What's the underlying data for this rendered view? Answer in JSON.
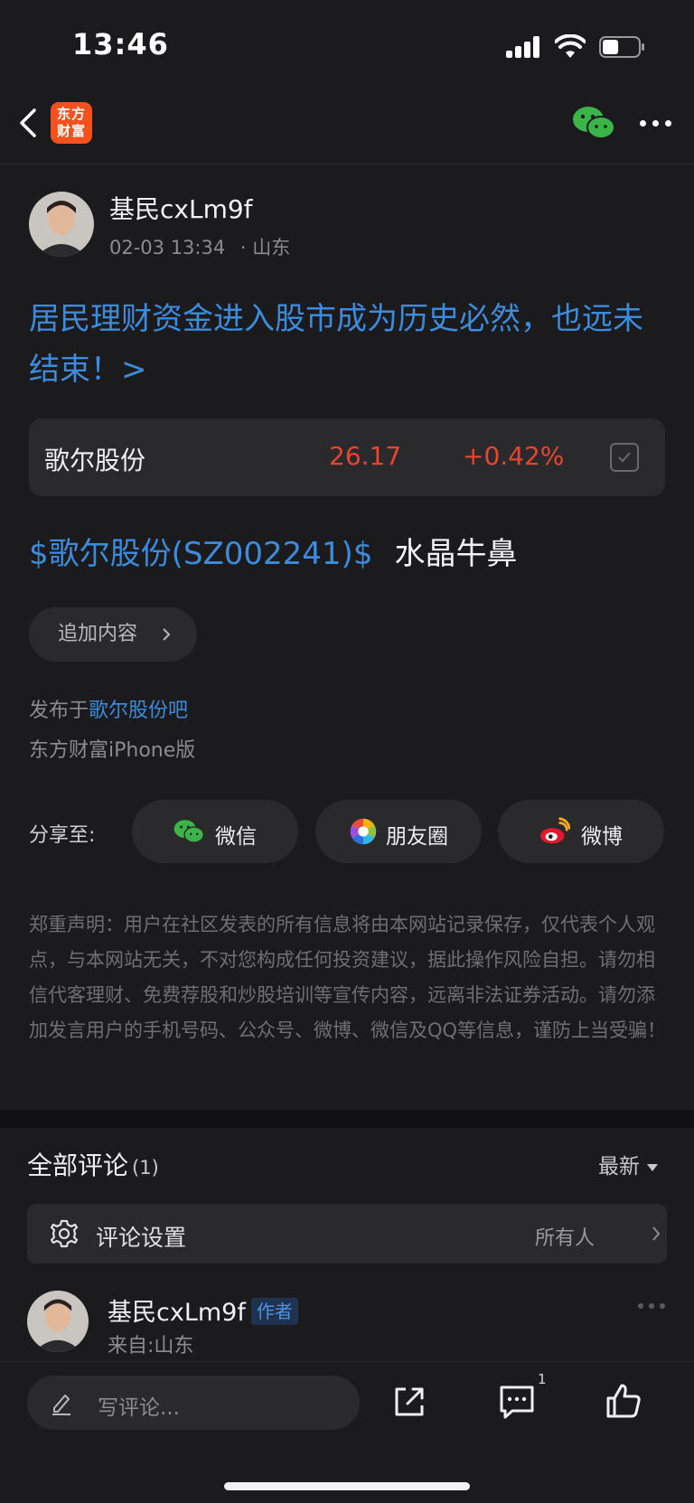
{
  "status_bar": {
    "time": "13:46",
    "battery_level": 0.45
  },
  "nav": {
    "logo_text_line1": "东方",
    "logo_text_line2": "财富"
  },
  "post": {
    "author_name": "基民cxLm9f",
    "timestamp": "02-03 13:34",
    "location": "· 山东",
    "title": "居民理财资金进入股市成为历史必然，也远未结束！>",
    "stock_card": {
      "name": "歌尔股份",
      "price": "26.17",
      "change": "+0.42%"
    },
    "stock_tag": "$歌尔股份(SZ002241)$",
    "body_text": "水晶牛鼻",
    "append_button": "追加内容",
    "publish_prefix": "发布于",
    "publish_forum": "歌尔股份吧",
    "device": "东方财富iPhone版"
  },
  "share": {
    "label": "分享至:",
    "wechat": "微信",
    "moments": "朋友圈",
    "weibo": "微博"
  },
  "disclaimer": "郑重声明：用户在社区发表的所有信息将由本网站记录保存，仅代表个人观点，与本网站无关，不对您构成任何投资建议，据此操作风险自担。请勿相信代客理财、免费荐股和炒股培训等宣传内容，远离非法证券活动。请勿添加发言用户的手机号码、公众号、微博、微信及QQ等信息，谨防上当受骗！",
  "comments": {
    "title": "全部评论",
    "count": "(1)",
    "sort": "最新",
    "settings_label": "评论设置",
    "settings_value": "所有人",
    "items": [
      {
        "name": "基民cxLm9f",
        "badge": "作者",
        "from": "来自:山东"
      }
    ]
  },
  "bottom_bar": {
    "input_placeholder": "写评论...",
    "comment_count": "1"
  },
  "colors": {
    "accent_blue": "#3d8bdc",
    "up_red": "#e5462f",
    "background": "#1b1b1d",
    "card": "#2a2a2d"
  }
}
